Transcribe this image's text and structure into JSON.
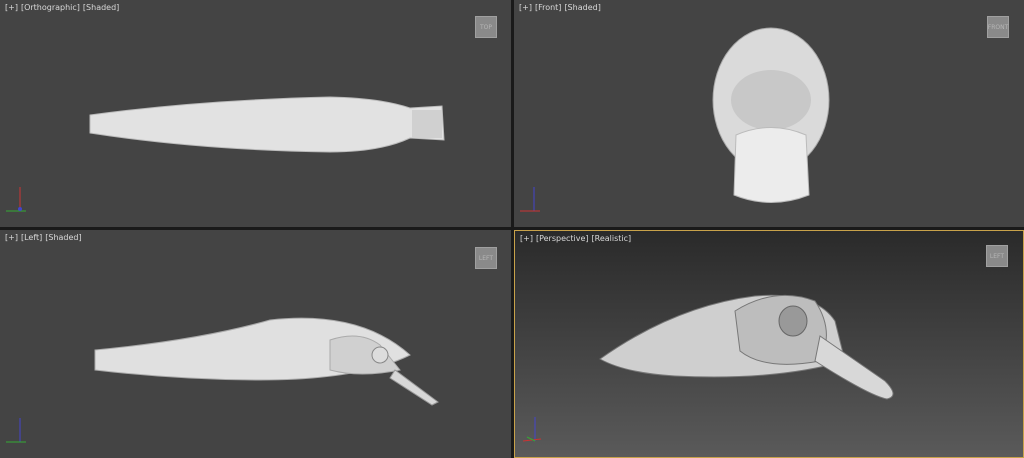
{
  "viewports": [
    {
      "plus": "[+]",
      "view": "[Orthographic]",
      "shading": "[Shaded]",
      "cube": "TOP"
    },
    {
      "plus": "[+]",
      "view": "[Front]",
      "shading": "[Shaded]",
      "cube": "FRONT"
    },
    {
      "plus": "[+]",
      "view": "[Left]",
      "shading": "[Shaded]",
      "cube": "LEFT"
    },
    {
      "plus": "[+]",
      "view": "[Perspective]",
      "shading": "[Realistic]",
      "cube": "LEFT"
    }
  ],
  "colors": {
    "active_border": "#c8a24a",
    "viewport_bg": "#444444",
    "model": "#e4e4e4"
  }
}
